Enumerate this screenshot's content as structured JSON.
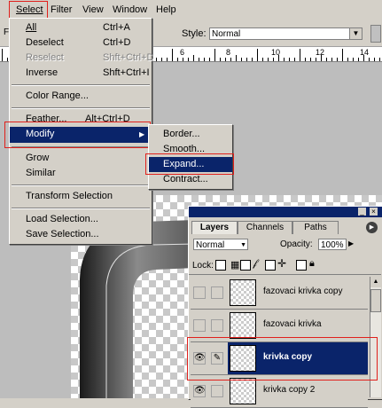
{
  "menubar": {
    "items": [
      "Select",
      "Filter",
      "View",
      "Window",
      "Help"
    ]
  },
  "options": {
    "style_label": "Style:",
    "style_value": "Normal"
  },
  "ruler": {
    "labels": [
      "6",
      "8",
      "10",
      "12",
      "14"
    ]
  },
  "select_menu": {
    "items": [
      {
        "label": "All",
        "shortcut": "Ctrl+A"
      },
      {
        "label": "Deselect",
        "shortcut": "Ctrl+D"
      },
      {
        "label": "Reselect",
        "shortcut": "Shft+Ctrl+D"
      },
      {
        "label": "Inverse",
        "shortcut": "Shft+Ctrl+I"
      },
      {
        "label": "Color Range..."
      },
      {
        "label": "Feather...",
        "shortcut": "Alt+Ctrl+D"
      },
      {
        "label": "Modify"
      },
      {
        "label": "Grow"
      },
      {
        "label": "Similar"
      },
      {
        "label": "Transform Selection"
      },
      {
        "label": "Load Selection..."
      },
      {
        "label": "Save Selection..."
      }
    ]
  },
  "modify_submenu": {
    "items": [
      "Border...",
      "Smooth...",
      "Expand...",
      "Contract..."
    ]
  },
  "layers_panel": {
    "tabs": [
      "Layers",
      "Channels",
      "Paths"
    ],
    "blend_mode": "Normal",
    "opacity_label": "Opacity:",
    "opacity_value": "100%",
    "lock_label": "Lock:",
    "layers": [
      {
        "name": "fazovaci krivka copy"
      },
      {
        "name": "fazovaci krivka"
      },
      {
        "name": "krivka copy"
      },
      {
        "name": "krivka copy 2"
      }
    ]
  },
  "colors": {
    "highlight": "#0a246a",
    "annotation_red": "#e0201c",
    "face": "#d4d0c8"
  }
}
